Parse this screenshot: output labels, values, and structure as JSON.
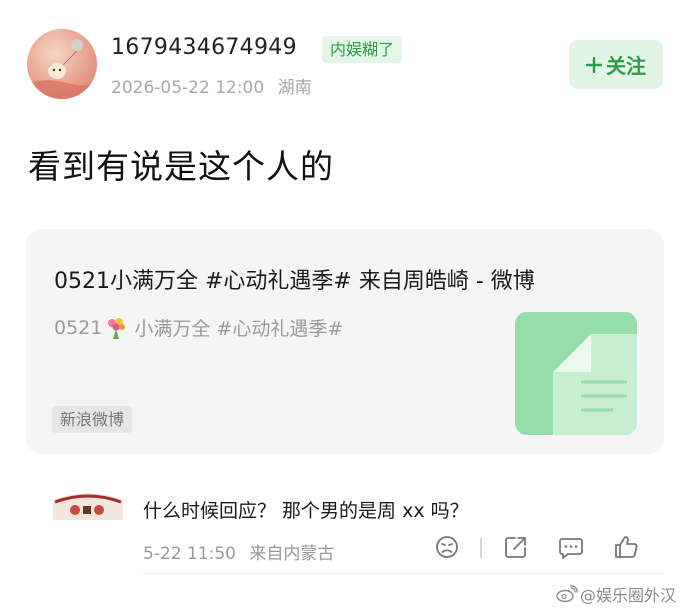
{
  "post": {
    "username": "1679434674949",
    "badge": "内娱糊了",
    "timestamp": "2026-05-22 12:00",
    "location": "湖南",
    "follow_label": "关注",
    "text": "看到有说是这个人的"
  },
  "link_card": {
    "title": "0521小满万全 #心动礼遇季# 来自周皓崎 - 微博",
    "desc_prefix": "0521",
    "desc_suffix": "小满万全 #心动礼遇季#",
    "source": "新浪微博"
  },
  "comment": {
    "text": "什么时候回应？ 那个男的是周 xx 吗？",
    "time": "5-22 11:50",
    "location": "来自内蒙古",
    "icons": [
      "dislike-icon",
      "share-icon",
      "comment-icon",
      "like-icon"
    ]
  },
  "watermark": {
    "text": "@娱乐圈外汉"
  },
  "colors": {
    "accent_green": "#2e9b45",
    "accent_green_bg": "#e3f6e6",
    "doc_green": "#95ddaa"
  }
}
